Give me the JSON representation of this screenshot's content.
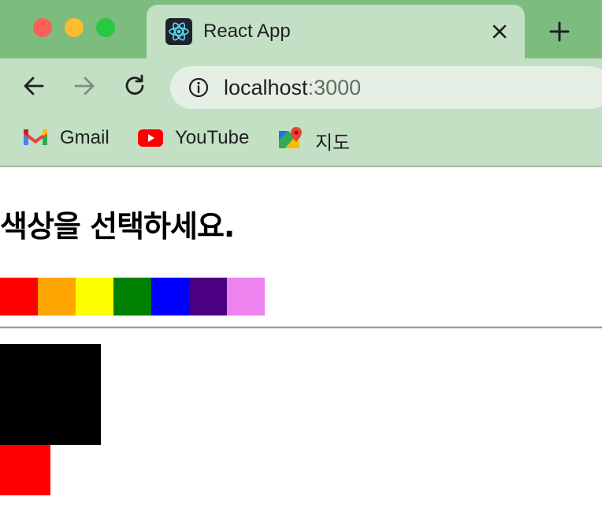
{
  "window": {
    "tab_title": "React App"
  },
  "toolbar": {
    "url_host": "localhost",
    "url_port": ":3000"
  },
  "bookmarks": [
    {
      "label": "Gmail",
      "icon": "gmail-icon"
    },
    {
      "label": "YouTube",
      "icon": "youtube-icon"
    },
    {
      "label": "지도",
      "icon": "maps-icon"
    }
  ],
  "page": {
    "title": "색상을 선택하세요.",
    "palette": [
      {
        "name": "red",
        "color": "#ff0000"
      },
      {
        "name": "orange",
        "color": "#ffa500"
      },
      {
        "name": "yellow",
        "color": "#ffff00"
      },
      {
        "name": "green",
        "color": "#008000"
      },
      {
        "name": "blue",
        "color": "#0000ff"
      },
      {
        "name": "indigo",
        "color": "#4b0082"
      },
      {
        "name": "violet",
        "color": "#ee82ee"
      }
    ],
    "preview_color": "#000000",
    "selected_color": "#ff0000"
  },
  "colors": {
    "tabstrip": "#7cbc7e",
    "toolbar": "#c3e0c4",
    "omnibox": "#e6efe6"
  }
}
